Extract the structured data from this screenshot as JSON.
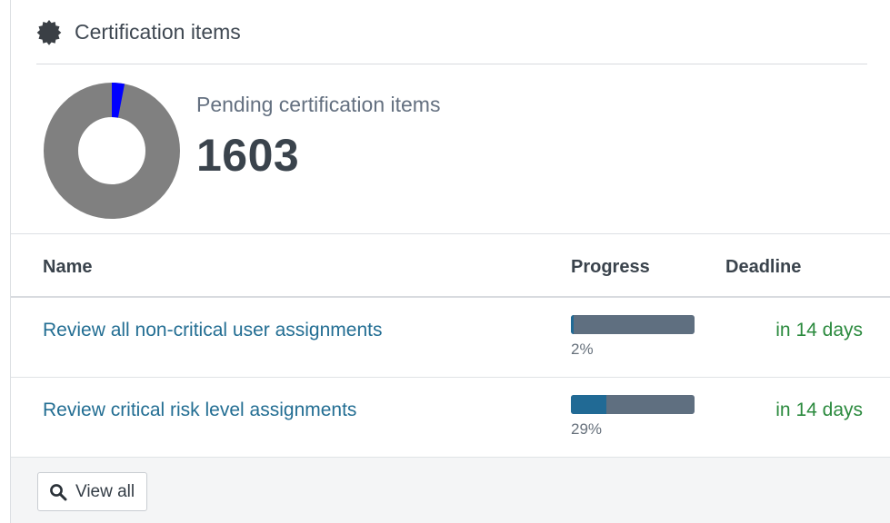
{
  "header": {
    "title": "Certification items",
    "icon": "certificate-badge-icon"
  },
  "summary": {
    "label": "Pending certification items",
    "count": "1603",
    "donut": {
      "completed_fraction": 0.03,
      "completed_color": "#0000ff",
      "remaining_color": "#808080"
    }
  },
  "table": {
    "columns": {
      "name": "Name",
      "progress": "Progress",
      "deadline": "Deadline"
    },
    "rows": [
      {
        "name": "Review all non-critical user assignments",
        "progress_value": 2,
        "progress_label": "2%",
        "deadline": "in 14 days"
      },
      {
        "name": "Review critical risk level assignments",
        "progress_value": 29,
        "progress_label": "29%",
        "deadline": "in 14 days"
      }
    ]
  },
  "footer": {
    "view_all_label": "View all",
    "view_all_icon": "search-icon"
  },
  "colors": {
    "link": "#236e93",
    "deadline": "#2b8a3e",
    "bar_track": "#5f6f80",
    "bar_fill": "#216a95"
  }
}
